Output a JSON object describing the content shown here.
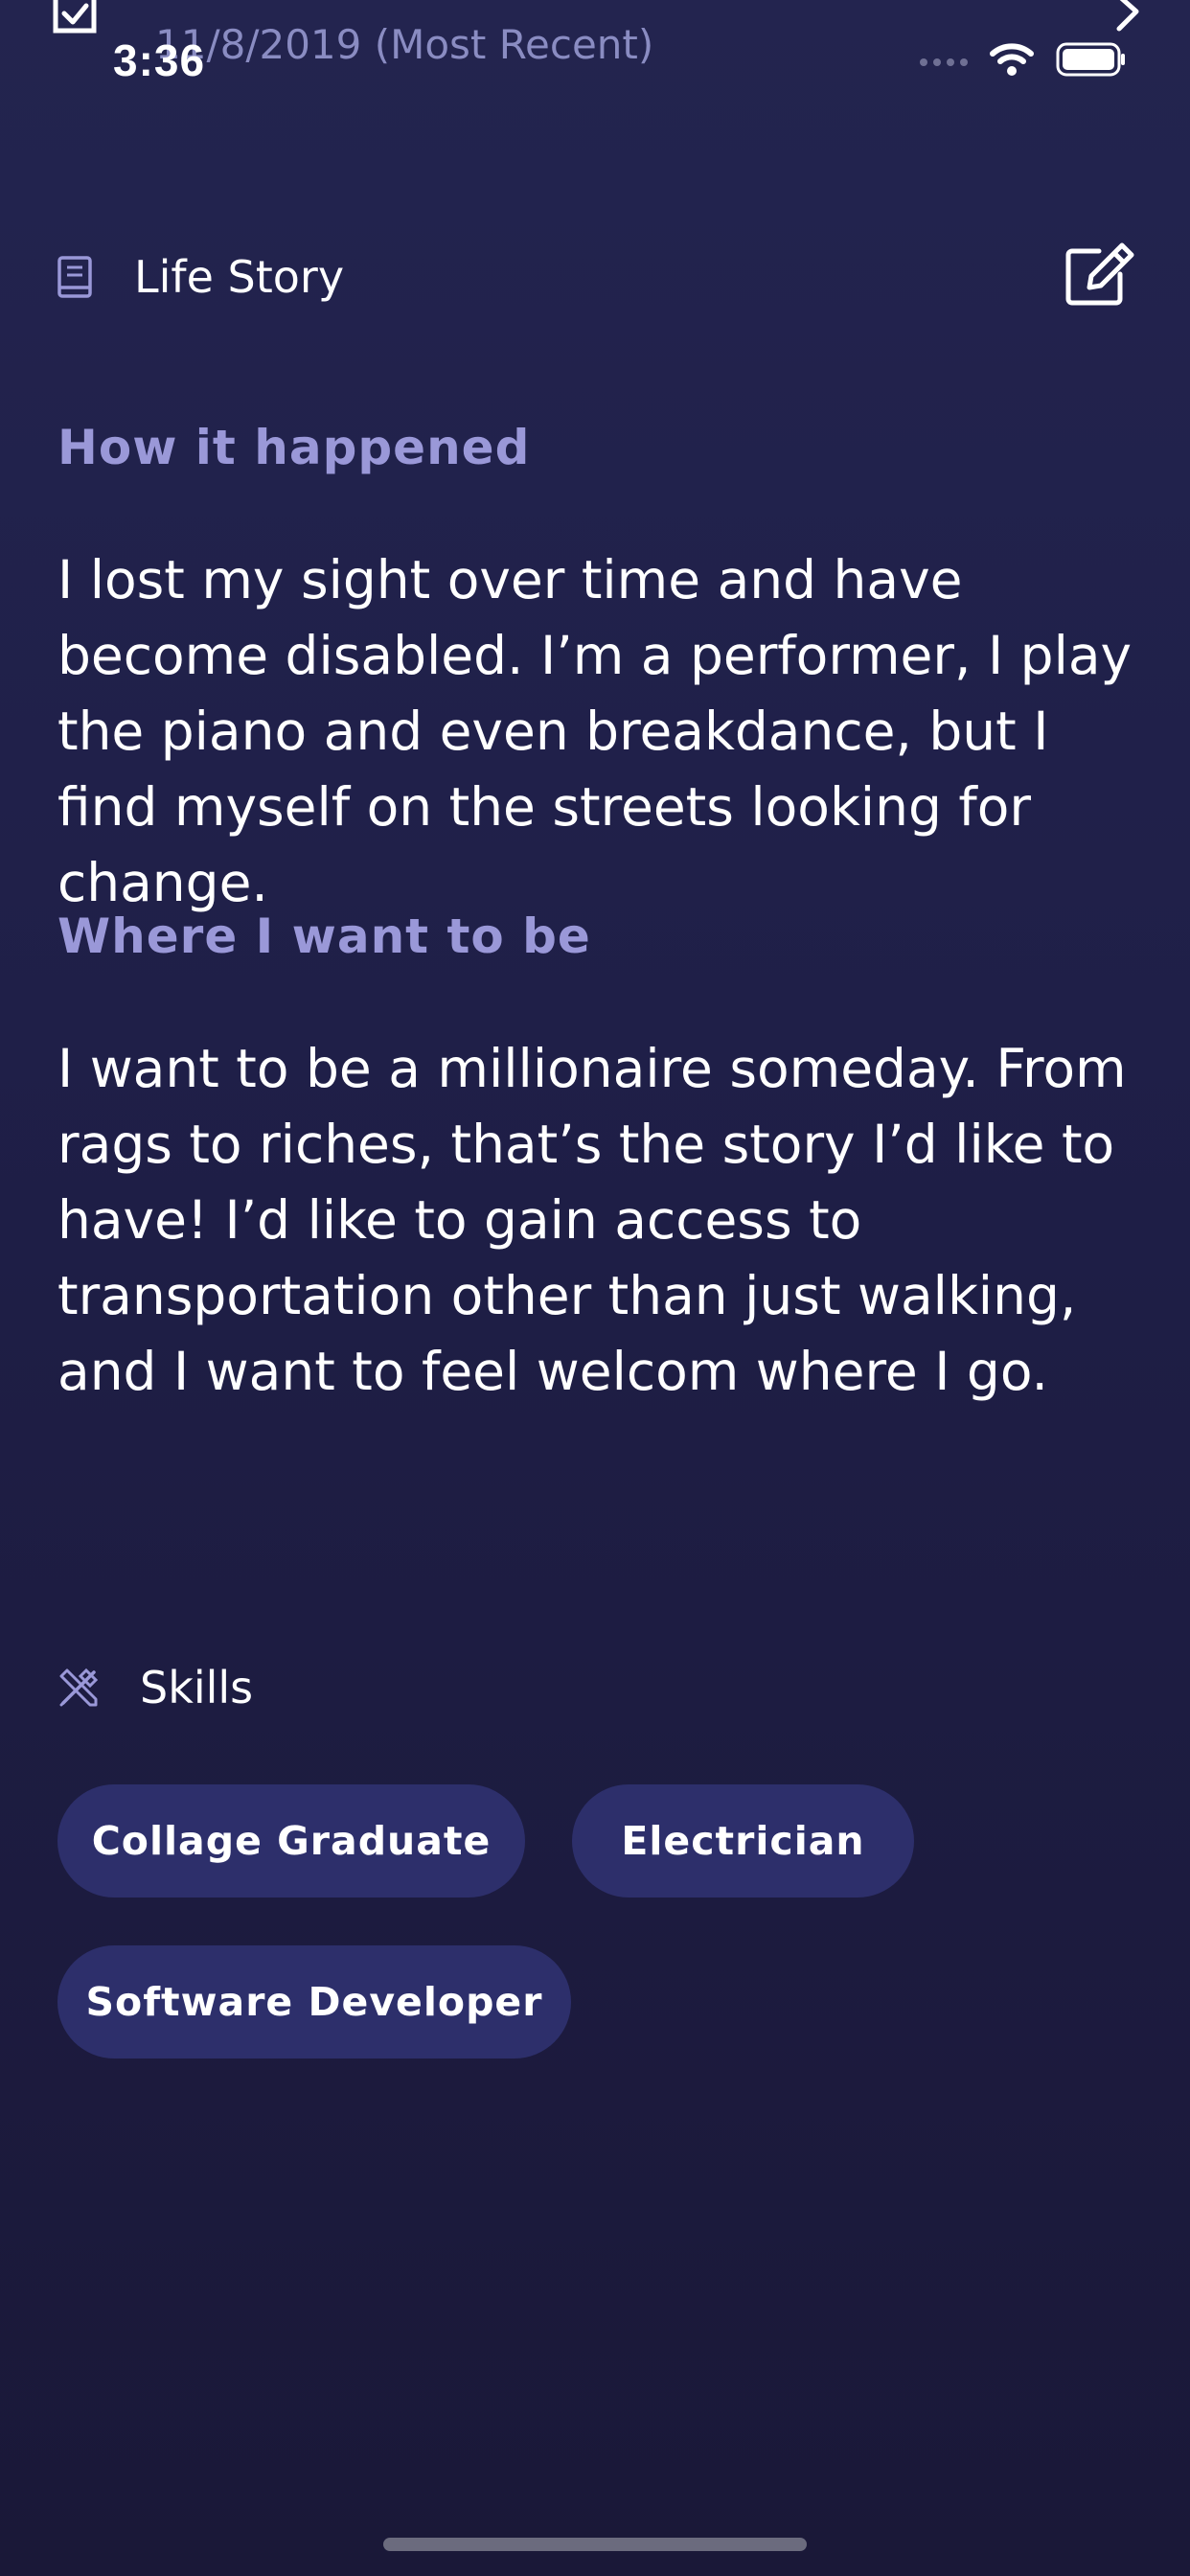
{
  "status_bar": {
    "time": "3:36"
  },
  "header": {
    "subtitle": "11/8/2019 (Most Recent)"
  },
  "life_story": {
    "section_label": "Life Story",
    "how_heading": "How it happened",
    "how_text": "I lost my sight over time and have become disabled. I’m a performer, I play the piano and even breakdance, but I find myself on the streets looking for change.",
    "where_heading": "Where I want to be",
    "where_text": "I want to be a millionaire someday. From rags to riches, that’s the story I’d like to have! I’d like to gain access to transportation other than just walking, and I want to feel welcom where I go."
  },
  "skills": {
    "section_label": "Skills",
    "chips": [
      "Collage Graduate",
      "Electrician",
      "Software Developer"
    ]
  },
  "icons": [
    "checkbox-icon",
    "chevron-right-icon",
    "signal-icon",
    "wifi-icon",
    "battery-icon",
    "book-icon",
    "edit-icon",
    "skills-icon"
  ],
  "colors": {
    "accent_heading": "#9a98d8",
    "chip_bg": "#2d2f6b",
    "background_top": "#23244f",
    "background_bottom": "#1a1838"
  }
}
